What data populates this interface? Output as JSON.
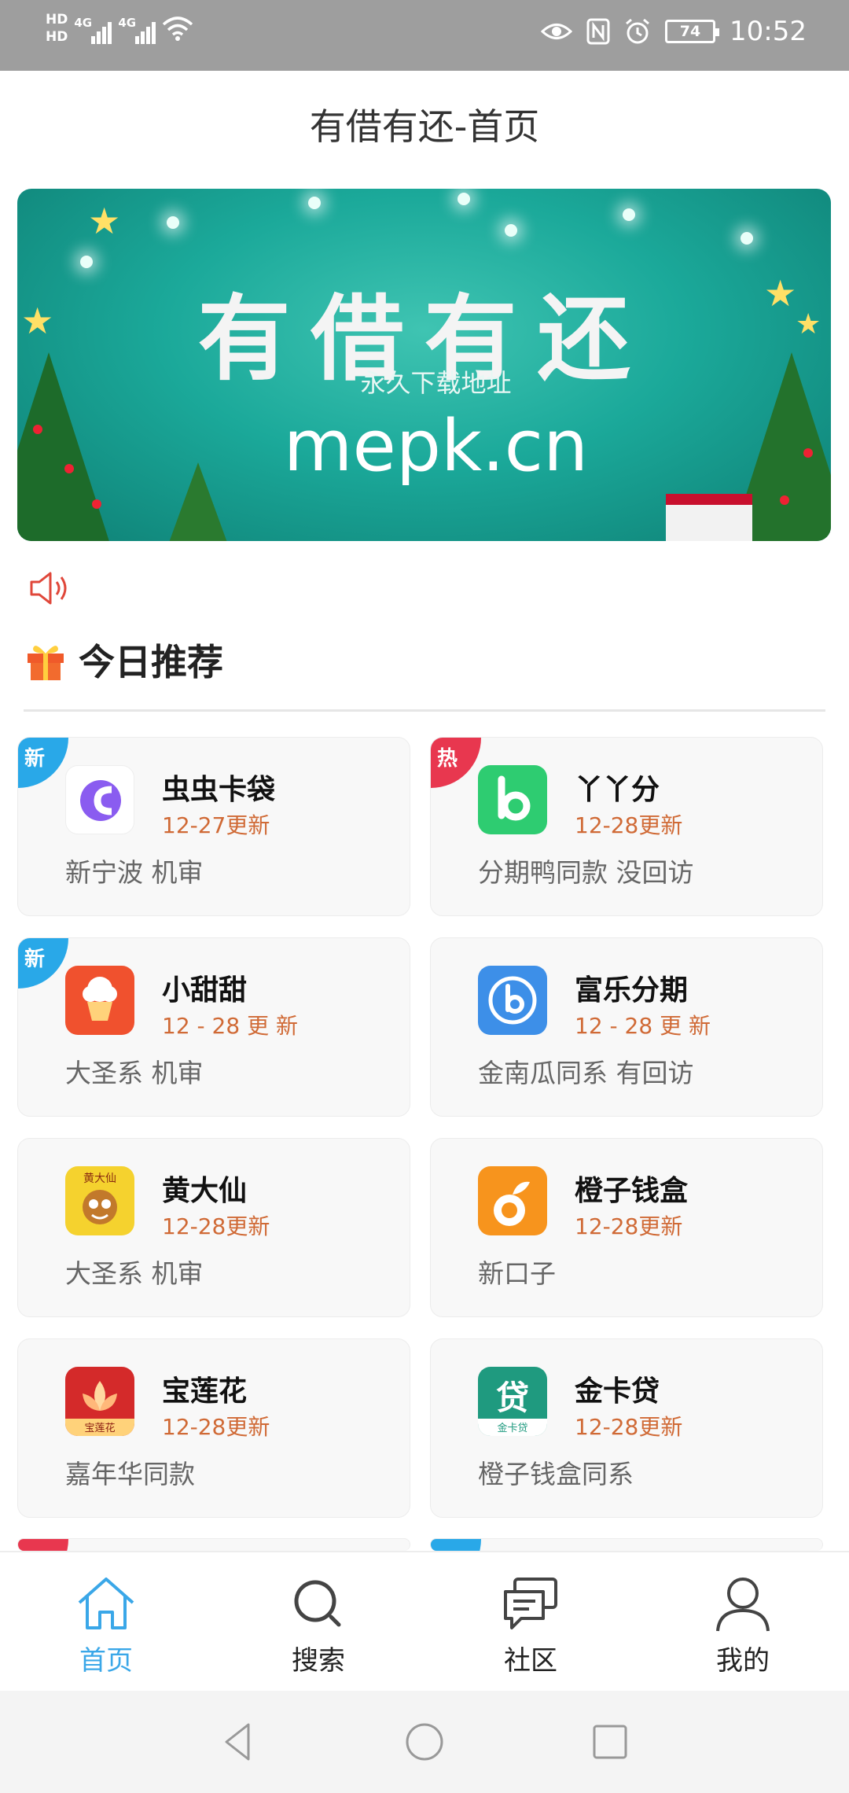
{
  "status_bar": {
    "hd1": "HD",
    "hd2": "HD",
    "net1": "4G",
    "net2": "4G",
    "battery": "74",
    "time": "10:52"
  },
  "header": {
    "title": "有借有还-首页"
  },
  "banner": {
    "title": "有借有还",
    "subtitle": "永久下载地址",
    "url": "mepk.cn"
  },
  "section": {
    "title": "今日推荐"
  },
  "cards": [
    {
      "badge": "新",
      "badge_type": "new",
      "name": "虫虫卡袋",
      "date": "12-27更新",
      "desc": "新宁波 机审",
      "icon": "chongchong-app-icon",
      "icon_color": "#ffffff"
    },
    {
      "badge": "热",
      "badge_type": "hot",
      "name": "丫丫分",
      "date": "12-28更新",
      "desc": "分期鸭同款 没回访",
      "icon": "yayafen-app-icon",
      "icon_color": "#2ecc71"
    },
    {
      "badge": "新",
      "badge_type": "new",
      "name": "小甜甜",
      "date": "12 - 28 更 新",
      "desc": "大圣系 机审",
      "icon": "xiaotiantian-app-icon",
      "icon_color": "#f0512e"
    },
    {
      "badge": "",
      "badge_type": "",
      "name": "富乐分期",
      "date": "12 - 28 更 新",
      "desc": "金南瓜同系 有回访",
      "icon": "fule-app-icon",
      "icon_color": "#3d8fe8"
    },
    {
      "badge": "",
      "badge_type": "",
      "name": "黄大仙",
      "date": "12-28更新",
      "desc": "大圣系 机审",
      "icon": "huangdaxian-app-icon",
      "icon_color": "#f5d22e",
      "icon_text": "黄大仙"
    },
    {
      "badge": "",
      "badge_type": "",
      "name": "橙子钱盒",
      "date": "12-28更新",
      "desc": "新口子",
      "icon": "chengzi-app-icon",
      "icon_color": "#f7941d"
    },
    {
      "badge": "",
      "badge_type": "",
      "name": "宝莲花",
      "date": "12-28更新",
      "desc": "嘉年华同款",
      "icon": "baolianhua-app-icon",
      "icon_color": "#d42a2a",
      "icon_text": "宝莲花"
    },
    {
      "badge": "",
      "badge_type": "",
      "name": "金卡贷",
      "date": "12-28更新",
      "desc": "橙子钱盒同系",
      "icon": "jinkadai-app-icon",
      "icon_color": "#1f9a7f",
      "icon_text": "贷",
      "icon_sub": "金卡贷"
    }
  ],
  "bottom_nav": [
    {
      "label": "首页",
      "icon": "home-icon",
      "active": true
    },
    {
      "label": "搜索",
      "icon": "search-icon",
      "active": false
    },
    {
      "label": "社区",
      "icon": "chat-icon",
      "active": false
    },
    {
      "label": "我的",
      "icon": "person-icon",
      "active": false
    }
  ],
  "colors": {
    "accent": "#3aa7e8",
    "date": "#d06a36",
    "badge_new": "#29a8e8",
    "badge_hot": "#e8374f"
  }
}
